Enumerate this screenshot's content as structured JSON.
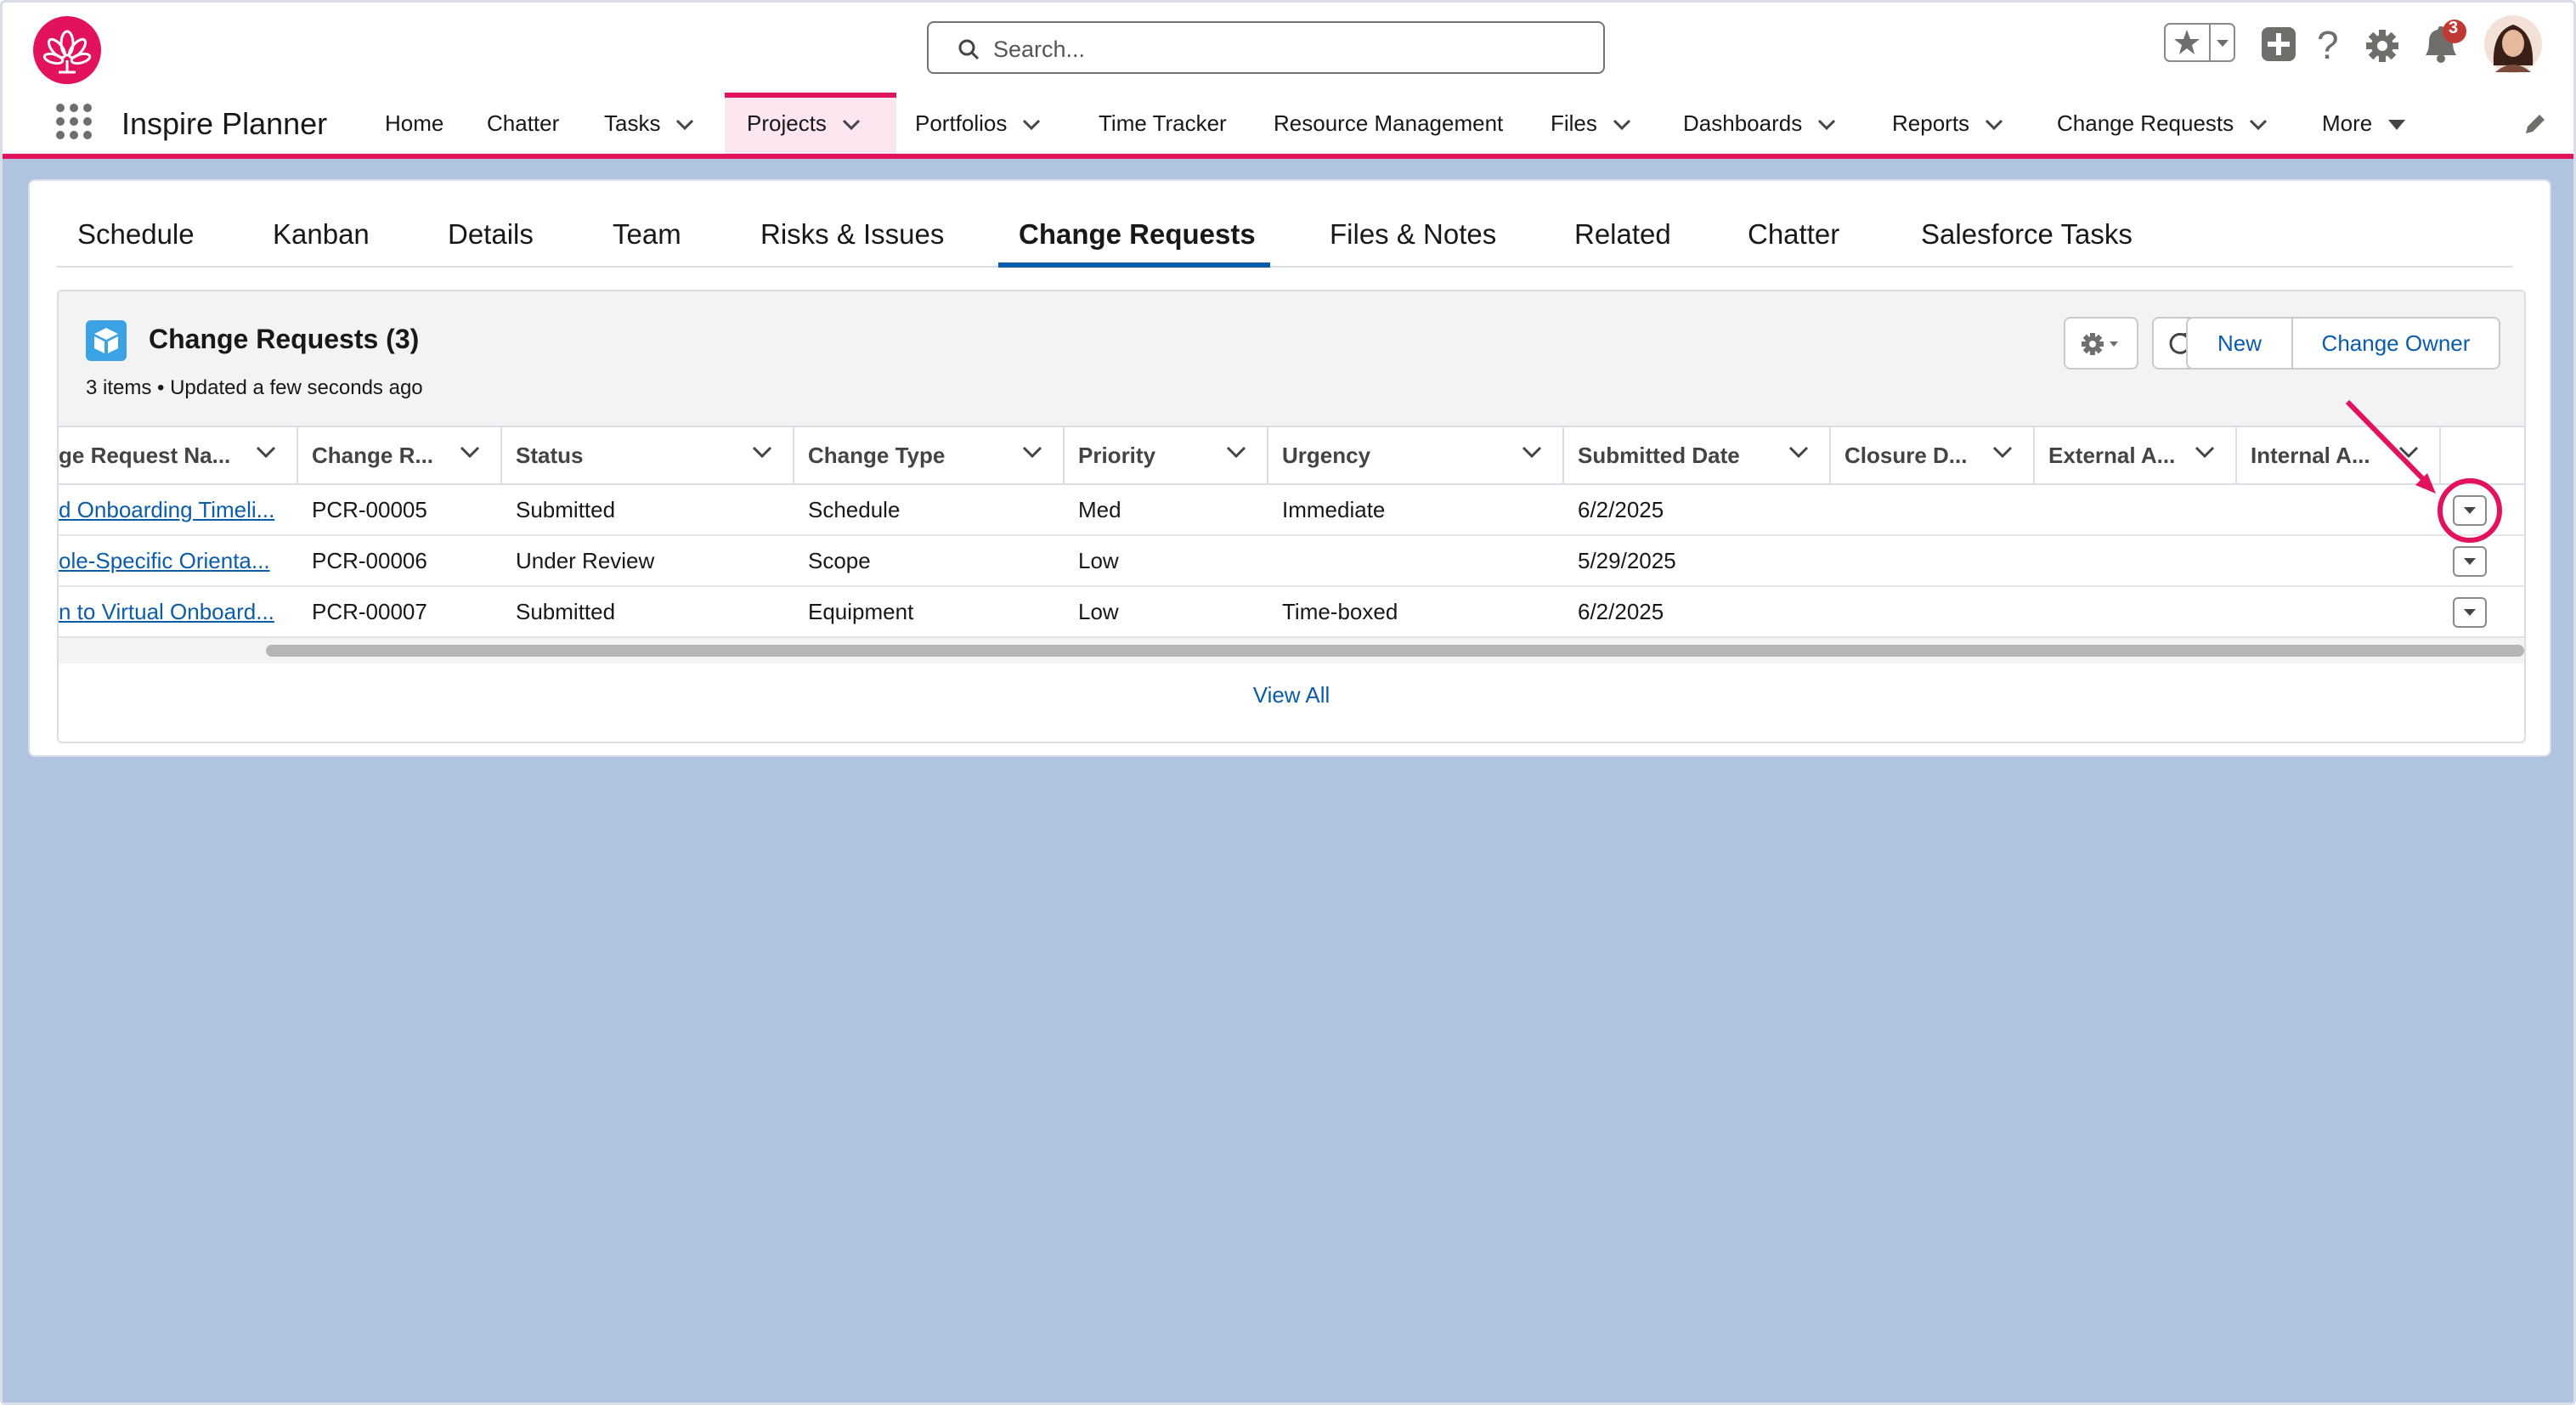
{
  "header": {
    "search_placeholder": "Search...",
    "notification_count": "3",
    "app_name": "Inspire Planner"
  },
  "nav": [
    {
      "label": "Home",
      "dropdown": false
    },
    {
      "label": "Chatter",
      "dropdown": false
    },
    {
      "label": "Tasks",
      "dropdown": true
    },
    {
      "label": "Projects",
      "dropdown": true,
      "active": true
    },
    {
      "label": "Portfolios",
      "dropdown": true
    },
    {
      "label": "Time Tracker",
      "dropdown": false
    },
    {
      "label": "Resource Management",
      "dropdown": false
    },
    {
      "label": "Files",
      "dropdown": true
    },
    {
      "label": "Dashboards",
      "dropdown": true
    },
    {
      "label": "Reports",
      "dropdown": true
    },
    {
      "label": "Change Requests",
      "dropdown": true
    },
    {
      "label": "More",
      "dropdown": true
    }
  ],
  "tabs": [
    "Schedule",
    "Kanban",
    "Details",
    "Team",
    "Risks & Issues",
    "Change Requests",
    "Files & Notes",
    "Related",
    "Chatter",
    "Salesforce Tasks"
  ],
  "active_tab": "Change Requests",
  "related_list": {
    "title": "Change Requests (3)",
    "subtitle": "3 items • Updated a few seconds ago",
    "new_label": "New",
    "change_owner_label": "Change Owner",
    "view_all": "View All"
  },
  "table": {
    "columns": [
      "ge Request Na...",
      "Change R...",
      "Status",
      "Change Type",
      "Priority",
      "Urgency",
      "Submitted Date",
      "Closure D...",
      "External A...",
      "Internal A..."
    ],
    "rows": [
      [
        "d Onboarding Timeli...",
        "PCR-00005",
        "Submitted",
        "Schedule",
        "Med",
        "Immediate",
        "6/2/2025",
        "",
        "",
        ""
      ],
      [
        "ole-Specific Orienta...",
        "PCR-00006",
        "Under Review",
        "Scope",
        "Low",
        "",
        "5/29/2025",
        "",
        "",
        ""
      ],
      [
        "n to Virtual Onboard...",
        "PCR-00007",
        "Submitted",
        "Equipment",
        "Low",
        "Time-boxed",
        "6/2/2025",
        "",
        "",
        ""
      ]
    ]
  },
  "colors": {
    "brand": "#e3125f",
    "link": "#0b5cab",
    "background": "#b0c4df"
  }
}
